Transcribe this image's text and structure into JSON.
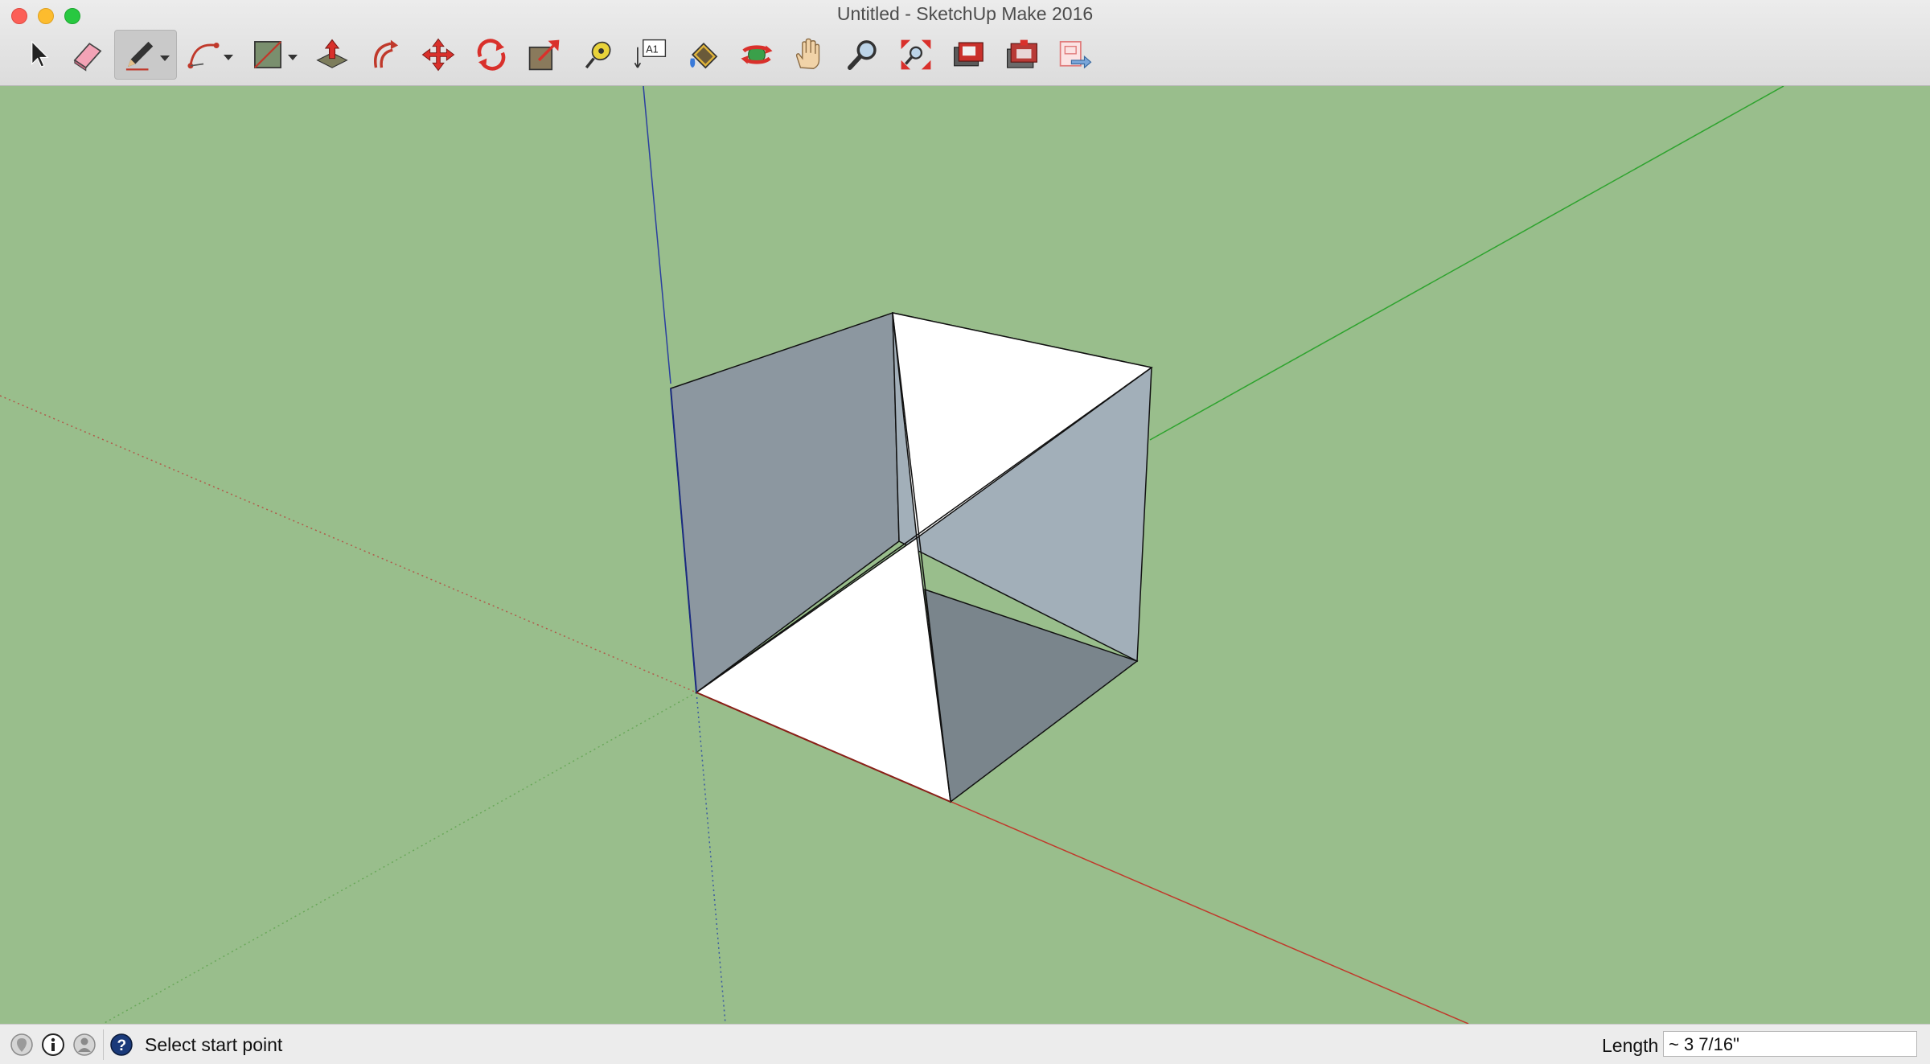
{
  "window": {
    "title": "Untitled - SketchUp Make 2016"
  },
  "toolbar": {
    "tools": [
      {
        "name": "select-tool",
        "icon": "arrow-cursor-icon"
      },
      {
        "name": "eraser-tool",
        "icon": "eraser-icon"
      },
      {
        "name": "line-tool",
        "icon": "pencil-icon",
        "active": true,
        "has_dropdown": true
      },
      {
        "name": "arc-tool",
        "icon": "arc-icon",
        "has_dropdown": true
      },
      {
        "name": "rectangle-tool",
        "icon": "rectangle-icon",
        "has_dropdown": true
      },
      {
        "name": "push-pull-tool",
        "icon": "push-pull-icon"
      },
      {
        "name": "offset-tool",
        "icon": "offset-icon"
      },
      {
        "name": "move-tool",
        "icon": "move-arrows-icon"
      },
      {
        "name": "rotate-tool",
        "icon": "rotate-icon"
      },
      {
        "name": "scale-tool",
        "icon": "scale-icon"
      },
      {
        "name": "tape-measure-tool",
        "icon": "tape-measure-icon"
      },
      {
        "name": "text-tool",
        "icon": "text-label-icon",
        "text": "A1"
      },
      {
        "name": "paint-bucket-tool",
        "icon": "paint-bucket-icon"
      },
      {
        "name": "orbit-tool",
        "icon": "orbit-icon"
      },
      {
        "name": "pan-tool",
        "icon": "hand-icon"
      },
      {
        "name": "zoom-tool",
        "icon": "magnifier-icon"
      },
      {
        "name": "zoom-extents-tool",
        "icon": "zoom-extents-icon"
      },
      {
        "name": "warehouse-tool",
        "icon": "3d-warehouse-icon"
      },
      {
        "name": "extension-warehouse-tool",
        "icon": "extension-warehouse-icon"
      },
      {
        "name": "send-to-layout-tool",
        "icon": "send-to-layout-icon"
      }
    ]
  },
  "statusbar": {
    "icons": [
      "geo-location-icon",
      "credits-icon",
      "user-account-icon",
      "help-icon"
    ],
    "status_text": "Select start point",
    "measurement_label": "Length",
    "measurement_value": "~ 3 7/16\""
  },
  "colors": {
    "background": "#99be8c",
    "red_axis": "#c0392b",
    "green_axis": "#2ea32e",
    "blue_axis": "#2a3fa0",
    "face_front": "#ffffff",
    "face_back": "#a8b4c2"
  }
}
